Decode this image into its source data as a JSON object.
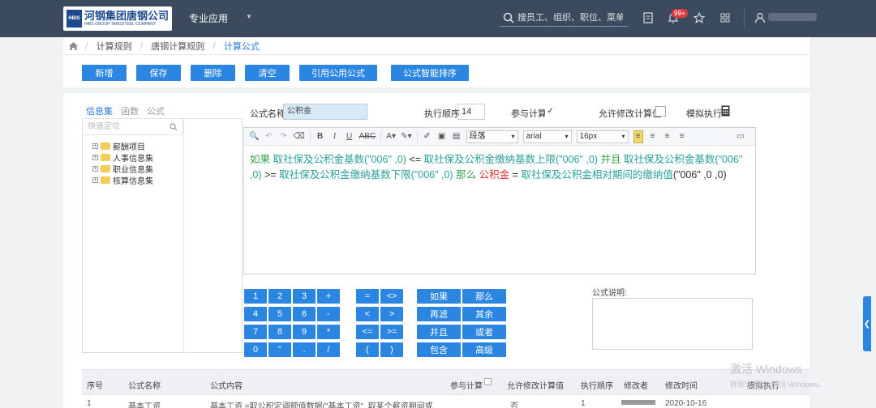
{
  "topbar": {
    "logo_badge": "HBIS",
    "logo_cn": "河钢集团唐钢公司",
    "logo_en": "HBIS GROUP TANGSTEEL COMPANY",
    "menu": "专业应用",
    "search_placeholder": "搜员工、组织、职位、菜单",
    "notif_count": "99+"
  },
  "breadcrumb": [
    "计算规则",
    "唐钢计算规则",
    "计算公式"
  ],
  "toolbar": {
    "add": "新增",
    "save": "保存",
    "delete": "删除",
    "clear": "清空",
    "cite": "引用公用公式",
    "sort": "公式智能排序"
  },
  "left_panel": {
    "tabs": [
      "信息集",
      "函数",
      "公式"
    ],
    "search_placeholder": "快速定位",
    "tree": [
      "薪酬项目",
      "人事信息集",
      "职业信息集",
      "核算信息集"
    ]
  },
  "form": {
    "name_label": "公式名称",
    "name_value": "公积金",
    "order_label": "执行顺序",
    "order_value": "14",
    "participate_label": "参与计算",
    "participate_checked": "✓",
    "allow_edit_label": "允许修改计算值",
    "simulate_label": "模拟执行"
  },
  "editor": {
    "para_select": "段落",
    "font_select": "arial",
    "size_select": "16px",
    "content": [
      {
        "t": "如果 ",
        "c": "kw"
      },
      {
        "t": "取社保及公积金基数(\"006\" ,0)",
        "c": "fn"
      },
      {
        "t": "  <=  ",
        "c": "txt"
      },
      {
        "t": "取社保及公积金缴纳基数上限(\"006\" ,0)",
        "c": "fn"
      },
      {
        "t": "  并且 ",
        "c": "kw"
      },
      {
        "t": "取社保及公积金基数(\"006\" ,0)",
        "c": "fn"
      },
      {
        "t": "  >=  ",
        "c": "txt"
      },
      {
        "t": "取社保及公积金缴纳基数下限(\"006\" ,0)",
        "c": "fn"
      },
      {
        "t": "  那么  ",
        "c": "kw"
      },
      {
        "t": "公积金",
        "c": "red"
      },
      {
        "t": "  =  ",
        "c": "txt"
      },
      {
        "t": "取社保及公积金相对期间的缴纳值",
        "c": "fn"
      },
      {
        "t": "(\"006\" ,0 ,0)",
        "c": "txt"
      }
    ]
  },
  "keypad": {
    "numbers": [
      "1",
      "2",
      "3",
      "+",
      "4",
      "5",
      "6",
      "-",
      "7",
      "8",
      "9",
      "*",
      "0",
      "\"",
      ".",
      "/"
    ],
    "ops": [
      "=",
      "<>",
      "<",
      ">",
      "<=",
      ">=",
      "(",
      ")"
    ],
    "logic": [
      "如果",
      "那么",
      "再滤",
      "其余",
      "并且",
      "或者",
      "包含",
      "高级"
    ]
  },
  "memo_label": "公式说明:",
  "table": {
    "headers": [
      "序号",
      "公式名称",
      "公式内容",
      "参与计算",
      "允许修改计算值",
      "执行顺序",
      "修改者",
      "修改时间",
      "模拟执行"
    ],
    "row": [
      "1",
      "基本工资",
      "基本工资 =取公积定调额值数据(\"基本工资\" ,取某个薪资期间或",
      "否",
      "1",
      "2020-10-16"
    ]
  },
  "watermark": {
    "line1": "激活 Windows",
    "line2": "转到\"设置\"以激活 Windows。"
  },
  "colors": {
    "topbar": "#3b4a5c",
    "button": "#2a86e0",
    "keyword": "#37a44a",
    "function": "#2aa198",
    "highlight": "#e03131"
  }
}
